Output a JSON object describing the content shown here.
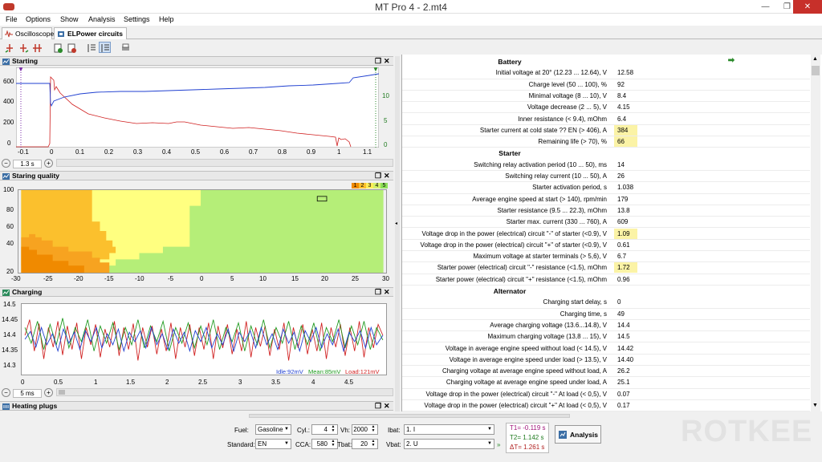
{
  "window": {
    "title": "MT Pro 4 - 2.mt4"
  },
  "menu": [
    "File",
    "Options",
    "Show",
    "Analysis",
    "Settings",
    "Help"
  ],
  "tabs": [
    {
      "label": "Oscilloscope"
    },
    {
      "label": "ELPower circuits"
    }
  ],
  "panels": {
    "starting": {
      "title": "Starting",
      "step": "1.3 s",
      "y_ticks_left": [
        "600",
        "400",
        "200",
        "0"
      ],
      "y_ticks_right": [
        "10",
        "5",
        "0"
      ],
      "x_ticks": [
        "-0.1",
        "0",
        "0.1",
        "0.2",
        "0.3",
        "0.4",
        "0.5",
        "0.6",
        "0.7",
        "0.8",
        "0.9",
        "1",
        "1.1"
      ]
    },
    "quality": {
      "title": "Staring quality",
      "levels": [
        "1",
        "2",
        "3",
        "4",
        "5"
      ],
      "y_ticks": [
        "100",
        "80",
        "60",
        "40",
        "20"
      ],
      "x_ticks": [
        "-30",
        "-25",
        "-20",
        "-15",
        "-10",
        "-5",
        "0",
        "5",
        "10",
        "15",
        "20",
        "25",
        "30"
      ]
    },
    "charging": {
      "title": "Charging",
      "step": "5 ms",
      "y_ticks": [
        "14.5",
        "14.45",
        "14.4",
        "14.35",
        "14.3"
      ],
      "x_ticks": [
        "0",
        "0.5",
        "1",
        "1.5",
        "2",
        "2.5",
        "3",
        "3.5",
        "4",
        "4.5"
      ],
      "legend": [
        {
          "label": "Idle:92mV",
          "color": "#1f3fd0"
        },
        {
          "label": "Mean:85mV",
          "color": "#1e9a1e"
        },
        {
          "label": "Load:121mV",
          "color": "#d01f1f"
        }
      ]
    },
    "heating": {
      "title": "Heating plugs"
    }
  },
  "results": [
    {
      "section": "Battery",
      "rows": [
        {
          "label": "Initial voltage at 20° (12.23 ... 12.64), V",
          "value": "12.58"
        },
        {
          "label": "Charge level (50 ... 100), %",
          "value": "92"
        },
        {
          "label": "Minimal voltage (8 ... 10), V",
          "value": "8.4"
        },
        {
          "label": "Voltage decrease (2 ... 5), V",
          "value": "4.15"
        },
        {
          "label": "Inner resistance (< 9.4), mOhm",
          "value": "6.4"
        },
        {
          "label": "Starter current at cold state ?? EN (> 406), A",
          "value": "384",
          "hl": true
        },
        {
          "label": "Remaining life (> 70), %",
          "value": "66",
          "hl": true
        }
      ]
    },
    {
      "section": "Starter",
      "rows": [
        {
          "label": "Switching relay activation period (10 ... 50), ms",
          "value": "14"
        },
        {
          "label": "Switching relay current (10 ... 50), A",
          "value": "26"
        },
        {
          "label": "Starter activation period, s",
          "value": "1.038"
        },
        {
          "label": "Average engine speed at start (> 140), rpm/min",
          "value": "179"
        },
        {
          "label": "Starter resistance (9.5 ... 22.3), mOhm",
          "value": "13.8"
        },
        {
          "label": "Starter max. current (330 ... 760), A",
          "value": "609"
        },
        {
          "label": "Voltage drop in the power (electrical) circuit \"-\" of starter (<0.9), V",
          "value": "1.09",
          "hl": true
        },
        {
          "label": "Voltage drop in the power (electrical) circuit \"+\" of starter (<0.9), V",
          "value": "0.61"
        },
        {
          "label": "Maximum voltage at starter terminals (> 5,6), V",
          "value": "6.7"
        },
        {
          "label": "Starter power (electrical) circuit \"-\" resistance (<1.5), mOhm",
          "value": "1.72",
          "hl": true
        },
        {
          "label": "Starter power (electrical) circuit \"+\" resistance (<1.5), mOhm",
          "value": "0.96"
        }
      ]
    },
    {
      "section": "Alternator",
      "rows": [
        {
          "label": "Charging start delay, s",
          "value": "0"
        },
        {
          "label": "Charging time, s",
          "value": "49"
        },
        {
          "label": "Average charging voltage (13.6...14.8), V",
          "value": "14.4"
        },
        {
          "label": "Maximum charging voltage (13,8 ... 15), V",
          "value": "14.5"
        },
        {
          "label": "Voltage in average engine speed without load (< 14.5), V",
          "value": "14.42"
        },
        {
          "label": "Voltage in average engine speed under load (> 13.5), V",
          "value": "14.40"
        },
        {
          "label": "Charging voltage at average engine speed without load, A",
          "value": "26.2"
        },
        {
          "label": "Charging voltage at average engine speed under load, A",
          "value": "25.1"
        },
        {
          "label": "Voltage drop in the power (electrical) circuit \"-\" At load (< 0,5), V",
          "value": "0.07"
        },
        {
          "label": "Voltage drop in the power (electrical) circuit \"+\" At load (< 0,5), V",
          "value": "0.17"
        }
      ]
    }
  ],
  "controls": {
    "fuel_label": "Fuel:",
    "fuel": "Gasoline",
    "standard_label": "Standard:",
    "standard": "EN",
    "cyl_label": "Cyl.:",
    "cyl": "4",
    "cca_label": "CCA:",
    "cca": "580",
    "vh_label": "Vh:",
    "vh": "2000",
    "tbat_label": "Tbat:",
    "tbat": "20",
    "ibat_label": "Ibat:",
    "ibat": "1. I",
    "vbat_label": "Vbat:",
    "vbat": "2. U",
    "t1": "T1= -0.119 s",
    "t2": "T2= 1.142 s",
    "dt": "ΔT= 1.261 s",
    "analysis_label": "Analysis"
  },
  "watermark": "ROTKEE"
}
